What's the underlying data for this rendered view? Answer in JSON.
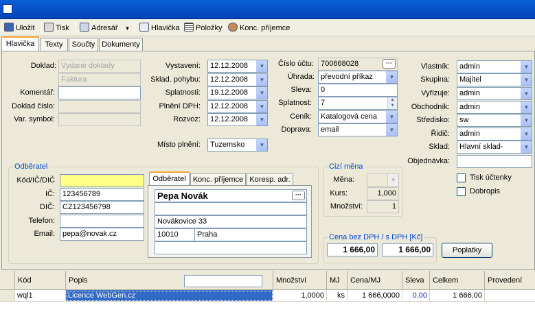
{
  "toolbar": {
    "save": "Uložit",
    "print": "Tisk",
    "addressbook": "Adresář",
    "header": "Hlavička",
    "items": "Položky",
    "end_recipient": "Konc. příjemce"
  },
  "tabs": [
    "Hlavička",
    "Texty",
    "Součty",
    "Dokumenty"
  ],
  "doc": {
    "doklad_label": "Doklad:",
    "doklad_value1": "Vydané doklady",
    "doklad_value2": "Faktura",
    "komentar_label": "Komentář:",
    "doklad_cislo_label": "Doklad číslo:",
    "var_symbol_label": "Var. symbol:"
  },
  "dates": {
    "vystaveni_label": "Vystavení:",
    "vystaveni": "12.12.2008",
    "sklad_label": "Sklad. pohybu:",
    "sklad": "12.12.2008",
    "splatnost_label": "Splatnosti:",
    "splatnost": "19.12.2008",
    "plneni_label": "Plnění DPH:",
    "plneni": "12.12.2008",
    "rozvoz_label": "Rozvoz:",
    "rozvoz": "12.12.2008",
    "misto_label": "Místo plnění:",
    "misto": "Tuzemsko"
  },
  "payment": {
    "ucet_label": "Číslo účtu:",
    "ucet": "700668028",
    "uhrada_label": "Úhrada:",
    "uhrada": "převodní příkaz",
    "sleva_label": "Sleva:",
    "sleva": "0",
    "splatnost_label": "Splatnost:",
    "splatnost": "7",
    "cenik_label": "Ceník:",
    "cenik": "Katalogová cena",
    "doprava_label": "Doprava:",
    "doprava": "email"
  },
  "owner": {
    "vlastnik_label": "Vlastník:",
    "vlastnik": "admin",
    "skupina_label": "Skupina:",
    "skupina": "Majitel",
    "vyrizuje_label": "Vyřizuje:",
    "vyrizuje": "admin",
    "obchodnik_label": "Obchodník:",
    "obchodnik": "admin",
    "stredisko_label": "Středisko:",
    "stredisko": "sw",
    "ridic_label": "Řidič:",
    "ridic": "admin",
    "sklad_label": "Sklad:",
    "sklad": "Hlavní sklad-",
    "objednavka_label": "Objednávka:",
    "tisk_uctenky": "Tisk účtenky",
    "dobropis": "Dobropis"
  },
  "odberatel": {
    "group_title": "Odběratel",
    "kod_label": "Kód/IČ/DIČ",
    "ic_label": "IČ:",
    "ic": "123456789",
    "dic_label": "DIČ:",
    "dic": "CZ123456798",
    "telefon_label": "Telefon:",
    "email_label": "Email:",
    "email": "pepa@novak.cz",
    "subtabs": [
      "Odběratel",
      "Konc. příjemce",
      "Koresp. adr."
    ],
    "name": "Pepa Novák",
    "street": "Novákovice 33",
    "zip": "10010",
    "city": "Praha"
  },
  "currency": {
    "group_title": "Cizí měna",
    "mena_label": "Měna:",
    "kurs_label": "Kurs:",
    "kurs": "1,000",
    "mnozstvi_label": "Množství:",
    "mnozstvi": "1"
  },
  "price": {
    "group_title": "Cena bez DPH / s DPH [Kč]",
    "bez_dph": "1 666,00",
    "s_dph": "1 666,00",
    "poplatky": "Poplatky"
  },
  "items_table": {
    "headers": [
      "Kód",
      "Popis",
      "Množství",
      "MJ",
      "Cena/MJ",
      "Sleva",
      "Celkem",
      "Provedení"
    ],
    "rows": [
      [
        "wql1",
        "Licence WebGen.cz",
        "1,0000",
        "ks",
        "1 666,0000",
        "0,00",
        "1 666,00",
        ""
      ]
    ]
  }
}
